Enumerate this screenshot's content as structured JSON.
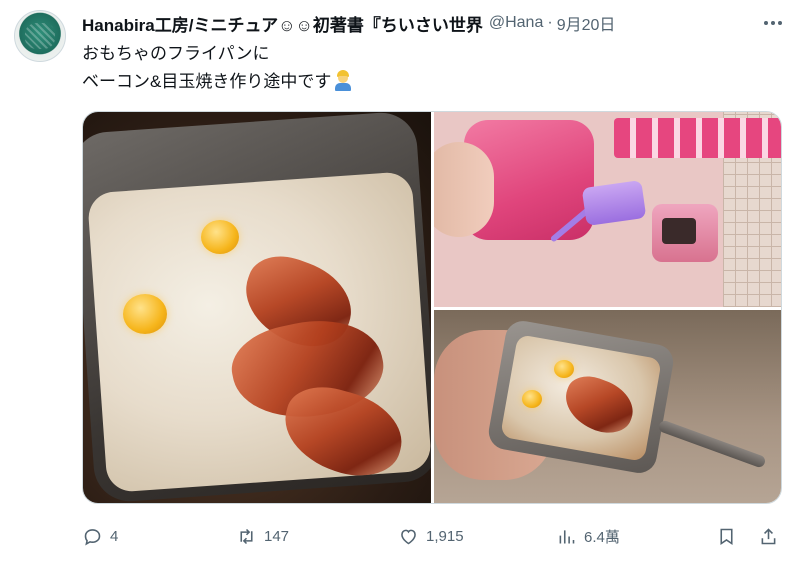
{
  "tweet": {
    "display_name": "Hanabira工房/ミニチュア☺☺初著書『ちいさい世界",
    "handle": "@Hana",
    "separator": "·",
    "date": "9月20日",
    "text_line1": "おもちゃのフライパンに",
    "text_line2": "ベーコン&目玉焼き作り途中です",
    "emoji": "construction-worker-emoji"
  },
  "media": {
    "photos": [
      {
        "name": "photo-main",
        "subject": "bacon-and-eggs-in-miniature-pan"
      },
      {
        "name": "photo-top-right",
        "subject": "pink-toy-kitchen-package"
      },
      {
        "name": "photo-bottom-right",
        "subject": "miniature-pan-held-in-hand"
      }
    ]
  },
  "actions": {
    "reply_count": "4",
    "retweet_count": "147",
    "like_count": "1,915",
    "view_count": "6.4萬"
  },
  "icons": {
    "more": "more-icon",
    "reply": "reply-icon",
    "retweet": "retweet-icon",
    "like": "heart-icon",
    "views": "views-icon",
    "bookmark": "bookmark-icon",
    "share": "share-icon"
  },
  "colors": {
    "text_primary": "#0f1419",
    "text_secondary": "#536471",
    "border": "#cfd9de"
  }
}
